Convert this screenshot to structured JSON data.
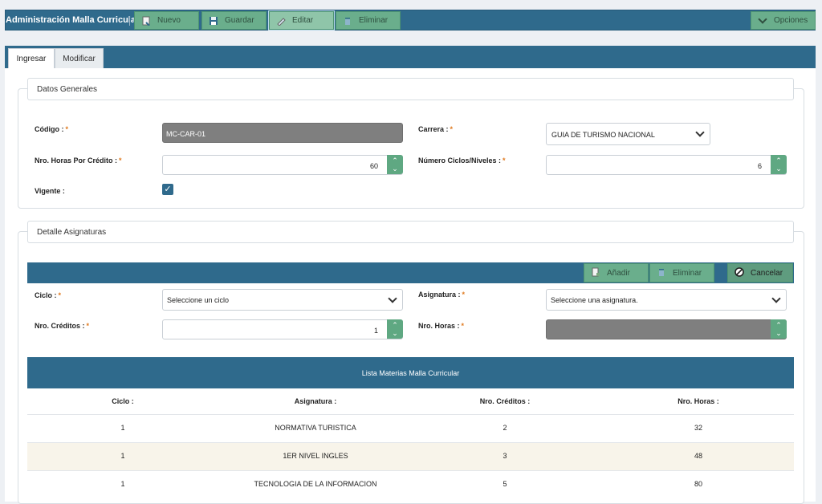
{
  "toolbar": {
    "title": "Administración Malla Curricular",
    "nuevo": "Nuevo",
    "guardar": "Guardar",
    "editar": "Editar",
    "eliminar": "Eliminar",
    "opciones": "Opciones"
  },
  "tabs": {
    "ingresar": "Ingresar",
    "modificar": "Modificar"
  },
  "general": {
    "legend": "Datos Generales",
    "codigo_label": "Código :",
    "codigo_value": "MC-CAR-01",
    "carrera_label": "Carrera :",
    "carrera_value": "GUIA DE TURISMO NACIONAL",
    "horas_label": "Nro. Horas Por Crédito :",
    "horas_value": "60",
    "ciclos_label": "Número Ciclos/Niveles :",
    "ciclos_value": "6",
    "vigente_label": "Vigente :",
    "required": "*"
  },
  "detalle": {
    "legend": "Detalle Asignaturas",
    "anadir": "Añadir",
    "eliminar": "Eliminar",
    "cancelar": "Cancelar",
    "ciclo_label": "Ciclo :",
    "ciclo_placeholder": "Seleccione un ciclo",
    "asignatura_label": "Asignatura :",
    "asignatura_placeholder": "Seleccione una asignatura.",
    "creditos_label": "Nro. Créditos :",
    "creditos_value": "1",
    "horas_label": "Nro. Horas :"
  },
  "table": {
    "title": "Lista Materias Malla Curricular",
    "columns": [
      "Ciclo :",
      "Asignatura :",
      "Nro. Créditos :",
      "Nro. Horas :"
    ],
    "rows": [
      [
        "1",
        "NORMATIVA TURISTICA",
        "2",
        "32"
      ],
      [
        "1",
        "1ER NIVEL INGLES",
        "3",
        "48"
      ],
      [
        "1",
        "TECNOLOGIA DE LA INFORMACION",
        "5",
        "80"
      ]
    ]
  }
}
